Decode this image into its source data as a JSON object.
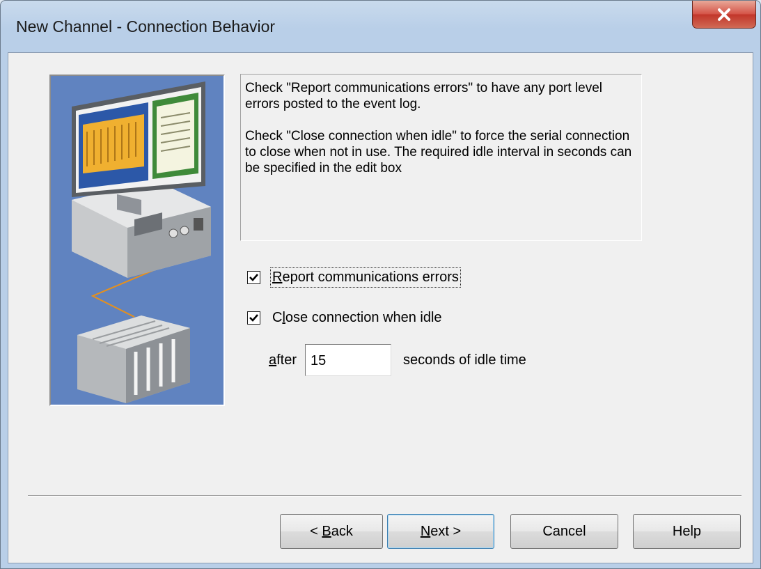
{
  "window": {
    "title": "New Channel - Connection Behavior"
  },
  "description": {
    "paragraph1": "Check \"Report communications errors\" to have any port level errors posted to the event log.",
    "paragraph2": "Check \"Close connection when idle\" to force the serial connection to close when not in use. The required idle interval in seconds can be specified in the edit box"
  },
  "options": {
    "report_errors": {
      "label_first": "R",
      "label_rest": "eport communications errors",
      "checked": true
    },
    "close_idle": {
      "label_first": "C",
      "label_mid": "l",
      "label_rest": "ose connection when idle",
      "checked": true
    },
    "after_label_first": "a",
    "after_label_rest": "fter",
    "idle_seconds": "15",
    "seconds_label": "seconds of idle time"
  },
  "buttons": {
    "back": {
      "prefix": "< ",
      "underlined": "B",
      "rest": "ack"
    },
    "next": {
      "underlined": "N",
      "rest": "ext >"
    },
    "cancel": "Cancel",
    "help": "Help"
  },
  "colors": {
    "illustration_bg": "#6083c0",
    "close_button": "#c2362a",
    "dialog_bg": "#f0f0f0"
  }
}
